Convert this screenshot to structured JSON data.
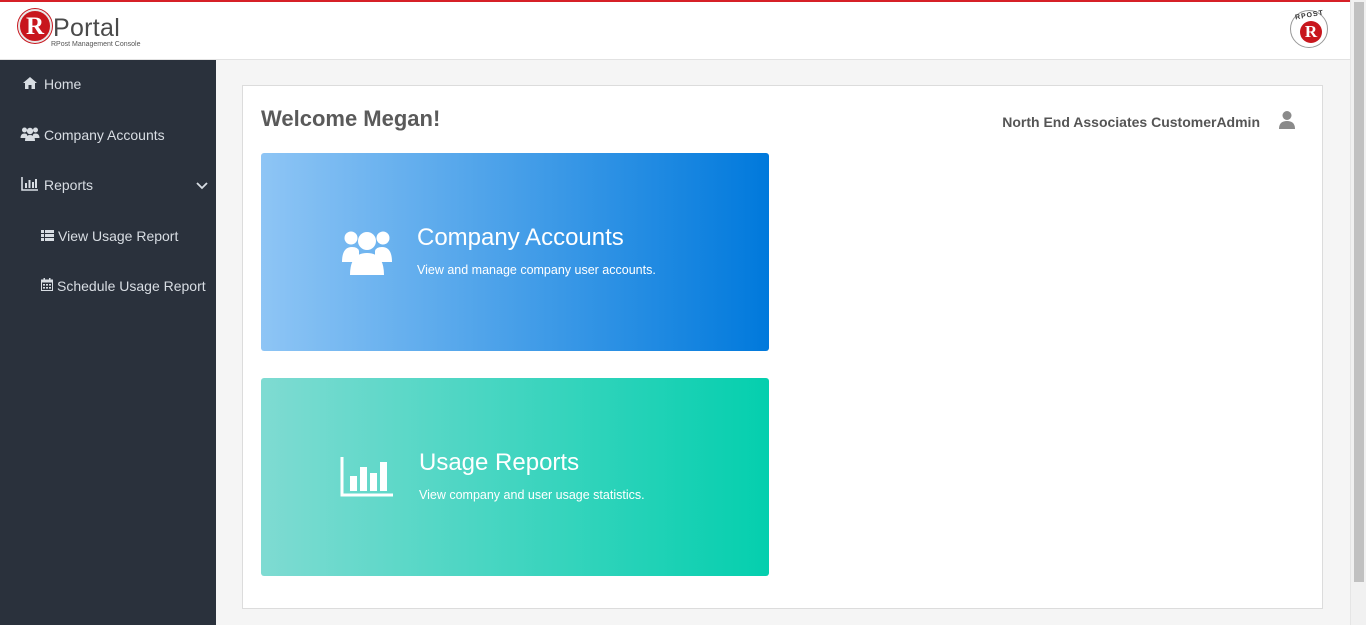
{
  "header": {
    "logo_letter": "R",
    "logo_word": "Portal",
    "logo_subtitle": "RPost Management Console",
    "badge_ring": "RPOST",
    "badge_letter": "R"
  },
  "sidebar": {
    "items": [
      {
        "label": "Home",
        "icon": "home-icon"
      },
      {
        "label": "Company Accounts",
        "icon": "users-icon"
      },
      {
        "label": "Reports",
        "icon": "bar-chart-icon"
      },
      {
        "label": "View Usage Report",
        "icon": "list-icon"
      },
      {
        "label": "Schedule Usage Report",
        "icon": "calendar-icon"
      }
    ]
  },
  "main": {
    "welcome": "Welcome Megan!",
    "user_label": "North End Associates CustomerAdmin",
    "tiles": [
      {
        "title": "Company Accounts",
        "description": "View and manage company user accounts.",
        "icon": "users-icon"
      },
      {
        "title": "Usage Reports",
        "description": "View company and user usage statistics.",
        "icon": "bar-chart-icon"
      }
    ]
  },
  "colors": {
    "accent_red": "#d62027",
    "sidebar_bg": "#2a313c",
    "tile_blue_start": "#8ec5f5",
    "tile_blue_end": "#0079dc",
    "tile_teal_start": "#7fdbd2",
    "tile_teal_end": "#04cfae"
  }
}
